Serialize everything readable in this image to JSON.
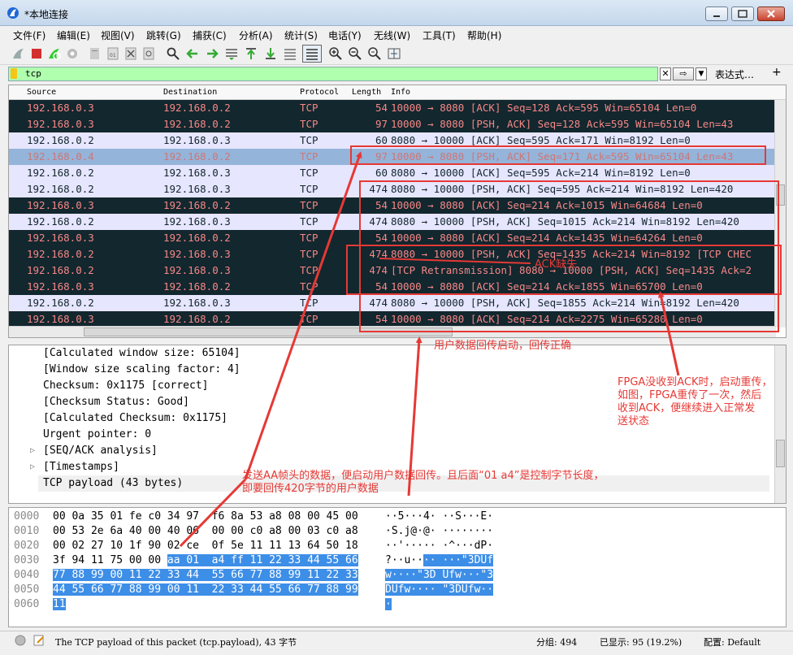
{
  "window": {
    "title": "*本地连接"
  },
  "menu": [
    "文件(F)",
    "编辑(E)",
    "视图(V)",
    "跳转(G)",
    "捕获(C)",
    "分析(A)",
    "统计(S)",
    "电话(Y)",
    "无线(W)",
    "工具(T)",
    "帮助(H)"
  ],
  "filter": {
    "value": "tcp",
    "expression_label": "表达式…",
    "plus": "+"
  },
  "columns": [
    "Source",
    "Destination",
    "Protocol",
    "Length",
    "Info"
  ],
  "packets": [
    {
      "src": "192.168.0.3",
      "dst": "192.168.0.2",
      "proto": "TCP",
      "len": "54",
      "info": "10000 → 8080 [ACK] Seq=128 Ack=595 Win=65104 Len=0",
      "style": "dark"
    },
    {
      "src": "192.168.0.3",
      "dst": "192.168.0.2",
      "proto": "TCP",
      "len": "97",
      "info": "10000 → 8080 [PSH, ACK] Seq=128 Ack=595 Win=65104 Len=43",
      "style": "dark"
    },
    {
      "src": "192.168.0.2",
      "dst": "192.168.0.3",
      "proto": "TCP",
      "len": "60",
      "info": "8080 → 10000 [ACK] Seq=595 Ack=171 Win=8192 Len=0",
      "style": "light"
    },
    {
      "src": "192.168.0.4",
      "dst": "192.168.0.2",
      "proto": "TCP",
      "len": "97",
      "info": "10000 → 8080 [PSH, ACK] Seq=171 Ack=595 Win=65104 Len=43",
      "style": "sel"
    },
    {
      "src": "192.168.0.2",
      "dst": "192.168.0.3",
      "proto": "TCP",
      "len": "60",
      "info": "8080 → 10000 [ACK] Seq=595 Ack=214 Win=8192 Len=0",
      "style": "light"
    },
    {
      "src": "192.168.0.2",
      "dst": "192.168.0.3",
      "proto": "TCP",
      "len": "474",
      "info": "8080 → 10000 [PSH, ACK] Seq=595 Ack=214 Win=8192 Len=420",
      "style": "light"
    },
    {
      "src": "192.168.0.3",
      "dst": "192.168.0.2",
      "proto": "TCP",
      "len": "54",
      "info": "10000 → 8080 [ACK] Seq=214 Ack=1015 Win=64684 Len=0",
      "style": "dark"
    },
    {
      "src": "192.168.0.2",
      "dst": "192.168.0.3",
      "proto": "TCP",
      "len": "474",
      "info": "8080 → 10000 [PSH, ACK] Seq=1015 Ack=214 Win=8192 Len=420",
      "style": "light"
    },
    {
      "src": "192.168.0.3",
      "dst": "192.168.0.2",
      "proto": "TCP",
      "len": "54",
      "info": "10000 → 8080 [ACK] Seq=214 Ack=1435 Win=64264 Len=0",
      "style": "dark"
    },
    {
      "src": "192.168.0.2",
      "dst": "192.168.0.3",
      "proto": "TCP",
      "len": "474",
      "info": "8080 → 10000 [PSH, ACK] Seq=1435 Ack=214 Win=8192 [TCP CHEC",
      "style": "dark"
    },
    {
      "src": "192.168.0.2",
      "dst": "192.168.0.3",
      "proto": "TCP",
      "len": "474",
      "info": "[TCP Retransmission] 8080 → 10000 [PSH, ACK] Seq=1435 Ack=2",
      "style": "dark"
    },
    {
      "src": "192.168.0.3",
      "dst": "192.168.0.2",
      "proto": "TCP",
      "len": "54",
      "info": "10000 → 8080 [ACK] Seq=214 Ack=1855 Win=65700 Len=0",
      "style": "dark"
    },
    {
      "src": "192.168.0.2",
      "dst": "192.168.0.3",
      "proto": "TCP",
      "len": "474",
      "info": "8080 → 10000 [PSH, ACK] Seq=1855 Ack=214 Win=8192 Len=420",
      "style": "light"
    },
    {
      "src": "192.168.0.3",
      "dst": "192.168.0.2",
      "proto": "TCP",
      "len": "54",
      "info": "10000 → 8080 [ACK] Seq=214 Ack=2275 Win=65280 Len=0",
      "style": "dark"
    }
  ],
  "details": [
    {
      "text": "[Calculated window size: 65104]",
      "expandable": false,
      "selected": false
    },
    {
      "text": "[Window size scaling factor: 4]",
      "expandable": false,
      "selected": false
    },
    {
      "text": "Checksum: 0x1175 [correct]",
      "expandable": false,
      "selected": false
    },
    {
      "text": "[Checksum Status: Good]",
      "expandable": false,
      "selected": false
    },
    {
      "text": "[Calculated Checksum: 0x1175]",
      "expandable": false,
      "selected": false
    },
    {
      "text": "Urgent pointer: 0",
      "expandable": false,
      "selected": false
    },
    {
      "text": "[SEQ/ACK analysis]",
      "expandable": true,
      "selected": false
    },
    {
      "text": "[Timestamps]",
      "expandable": true,
      "selected": false
    },
    {
      "text": "TCP payload (43 bytes)",
      "expandable": false,
      "selected": true
    }
  ],
  "bytes": [
    {
      "offset": "0000",
      "hex_pre": "00 0a 35 01 fe c0 34 97  f6 8a 53 a8 08 00 45 00",
      "hex_sel": "",
      "hex_post": "",
      "ascii_pre": "··5···4· ··S···E·",
      "ascii_sel": "",
      "ascii_post": ""
    },
    {
      "offset": "0010",
      "hex_pre": "00 53 2e 6a 40 00 40 06  00 00 c0 a8 00 03 c0 a8",
      "hex_sel": "",
      "hex_post": "",
      "ascii_pre": "·S.j@·@· ········",
      "ascii_sel": "",
      "ascii_post": ""
    },
    {
      "offset": "0020",
      "hex_pre": "00 02 27 10 1f 90 02 ce  0f 5e 11 11 13 64 50 18",
      "hex_sel": "",
      "hex_post": "",
      "ascii_pre": "··'····· ·^···dP·",
      "ascii_sel": "",
      "ascii_post": ""
    },
    {
      "offset": "0030",
      "hex_pre": "3f 94 11 75 00 00 ",
      "hex_sel": "aa 01  a4 ff 11 22 33 44 55 66",
      "hex_post": "",
      "ascii_pre": "?··u··",
      "ascii_sel": "·· ···\"3DUf",
      "ascii_post": ""
    },
    {
      "offset": "0040",
      "hex_pre": "",
      "hex_sel": "77 88 99 00 11 22 33 44  55 66 77 88 99 11 22 33",
      "hex_post": "",
      "ascii_pre": "",
      "ascii_sel": "w····\"3D Ufw···\"3",
      "ascii_post": ""
    },
    {
      "offset": "0050",
      "hex_pre": "",
      "hex_sel": "44 55 66 77 88 99 00 11  22 33 44 55 66 77 88 99",
      "hex_post": "",
      "ascii_pre": "",
      "ascii_sel": "DUfw···· \"3DUfw··",
      "ascii_post": ""
    },
    {
      "offset": "0060",
      "hex_pre": "",
      "hex_sel": "11",
      "hex_post": "",
      "ascii_pre": "",
      "ascii_sel": "·",
      "ascii_post": ""
    }
  ],
  "status": {
    "field_info": "The TCP payload of this packet (tcp.payload), 43 字节",
    "packets": "分组: 494",
    "displayed": "已显示: 95 (19.2%)",
    "profile": "配置: Default"
  },
  "annotations": {
    "ack_lost": "ACK缺失",
    "data_ok": "用户数据回传启动，回传正确",
    "fpga_retrans": [
      "FPGA没收到ACK时，启动重传，",
      "如图，FPGA重传了一次，然后",
      "收到ACK，便继续进入正常发",
      "送状态"
    ],
    "aa_header": [
      "发送AA帧头的数据，便启动用户数据回传。且后面“01 a4”是控制字节长度，",
      "即要回传420字节的用户数据"
    ],
    "color": "#e53935"
  }
}
